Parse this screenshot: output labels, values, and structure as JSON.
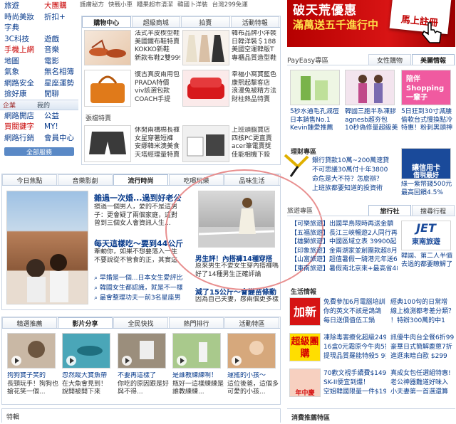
{
  "nav": {
    "rows": [
      [
        "旅遊",
        "大團購"
      ],
      [
        "時尚美妝",
        "折扣+"
      ],
      [
        "字典",
        ""
      ],
      [
        "3C科技",
        "遊戲"
      ],
      [
        "手機上網",
        "音樂"
      ],
      [
        "地圖",
        "電影"
      ],
      [
        "氣象",
        "無名相簿"
      ],
      [
        "網路安全",
        "星座運勢"
      ],
      [
        "撿好康",
        "閒聊"
      ]
    ],
    "enterprise_label": "企業",
    "mine_label": "我的",
    "rows2": [
      [
        "網路開店",
        "公益"
      ],
      [
        "買關鍵字",
        "MY!"
      ],
      [
        "網路行銷",
        "會員中心"
      ]
    ],
    "all_services": "全部服務"
  },
  "topstrip": {
    "items": [
      "護膚秘方",
      "快戰小車",
      "糟果超市清潔",
      "韓國卜洋裝",
      "台灣299免運"
    ]
  },
  "shop": {
    "tabs": [
      "購物中心",
      "超級商城",
      "拍賣",
      "活動特報"
    ],
    "items": [
      [
        "法式羊皮楔型鞋",
        "美國鐵布鞋特賣",
        "KOKKO新鞋",
        "新款布鞋2雙999"
      ],
      [
        "韓布品牌小洋裝",
        "日韓洋裝＄188",
        "美國空運韓版T",
        "專櫃品質造型鞋"
      ],
      [
        "復古真皮兩用包",
        "PRADA特價",
        "viv該選包款",
        "COACH手提"
      ],
      [
        "幸福小窩寶藍色",
        "康熙起擊客店",
        "浪漫兔被精方法",
        "財柱熱品特賣"
      ],
      [
        "休閒兩構棉長褲",
        "女星穿著短褲",
        "安娜韓米澳美食",
        "天塔經理量特賣"
      ],
      [
        "上班頭腦寶店",
        "四核PC更直賣",
        "acer筆電賣獎",
        "佳能相機下殺"
      ]
    ],
    "special_label": "張檔特賣"
  },
  "hero": {
    "line1": "破天荒優惠",
    "line2": "滿萬送五千進行中",
    "button": "馬上註冊"
  },
  "payeasy": {
    "title": "PayEasy專區",
    "tabs": [
      "女性購物",
      "美麗情報"
    ],
    "banner": "陪伴Shopping 一輩子",
    "captions": [
      [
        "5秒水通毛孔減痘",
        "日本銷售No.1",
        "Kevin鍾愛推薦"
      ],
      [
        "韓國三胞半系凍膠",
        "agnesb超夯包",
        "10秒偽修量超級美"
      ],
      [
        "5日狂到30寸減腰",
        "偷軟台式慢換點冷",
        "特惠！粉刺黑頭神"
      ]
    ]
  },
  "finance": {
    "title": "理財專區",
    "items": [
      "銀行貸款10萬~200萬速貸",
      "不可思議30萬付十年3800",
      "命危是大不符？怎麼辦？",
      "上班族都要知道的投資術"
    ],
    "card_title": "讓信用卡",
    "card_sub": "借現最好",
    "card_cap": [
      "綠一紫幣錢500元",
      "最高回饋4.5%"
    ]
  },
  "travel": {
    "title": "旅遊專區",
    "tabs": [
      "旅行社",
      "搜尋行程"
    ],
    "items": [
      "【可樂旅遊】出國早鳥限時再送金額",
      "【五福旅遊】長江三峽暢遊2人同行再4千",
      "【雄獅旅遊】中國區域立表 39900起",
      "【印象旅遊】金兩湖家並創團款超8月",
      "【山富旅遊】超值暑假一騎港元年送6千",
      "【東南旅遊】暑假南北京來+最高省48900"
    ],
    "jet_title": "東南旅遊",
    "jet_cap": [
      "韓國、第二人半價",
      "去過的都要瞭解了"
    ]
  },
  "life": {
    "title": "生活情報",
    "rows": [
      {
        "badge": "加新",
        "lines": [
          "免費參加6月電腦培訓",
          "你的英文不該是鴿鴿",
          "每日送價值伍工鍋"
        ],
        "right": [
          "經典100句的日常增",
          "線上檢測都考差分類？",
          "！特辦300萬的中1"
        ]
      },
      {
        "badge": "超級團購",
        "lines": [
          "凍除毒害療化超級249",
          "16盒0元霜原今牛肉5折",
          "提現品質羅能特殺5 9折"
        ],
        "right": [
          "訊優牛肉台全餐6折99",
          "豪華日式簡解鹿蔥7折",
          "進逛來暗白歐 $299"
        ]
      },
      {
        "badge": "年中慶",
        "lines": [
          "70歡文視手續費$149",
          "SK-II便宜到爆！",
          "空姐韓國限量一件$199"
        ],
        "right": [
          "真成女包任選組特惠!",
          "老公神器難道好味入",
          "小夫妻第一首選還算"
        ]
      }
    ]
  },
  "consumer_title": "消費推薦特區",
  "feature": {
    "tabs": [
      "今日焦點",
      "音樂影劇",
      "流行時尚",
      "吃喝玩樂",
      "品味生活"
    ],
    "main_title": "雜過一次婚...過到好老公",
    "main_text": [
      "擦過一個男人，愛的不是這男",
      "子：更會疑了兩個家庭，這對",
      "曾到三個女人會資訊人生..."
    ],
    "sub_title": "每天這樣吃～要到44公斤",
    "sub_text": [
      "牽動你，如果不想要落入一生",
      "不要說從不管食的正，其實這"
    ],
    "links": [
      "早婚是一個...日本女生愛評比",
      "韓國女生都認識，就是不一樣",
      "最會整理功夫一前3名星座男"
    ],
    "side_title": "男生評！內搭褲14種穿搭",
    "side_text": [
      "原來男生不愛女生穿內搭褲嗎",
      "好了14種男生正確評論"
    ],
    "side_link_title": "減了15公斤～會變苗條動",
    "side_link_text": "因為自己夫妻，感兩個更多樣"
  },
  "video": {
    "tabs": [
      "精選推薦",
      "影片分享",
      "全民快找",
      "熱門排行",
      "活動特區"
    ],
    "captions": [
      [
        "狗狗寶子笑的",
        "長頸玩手！狗狗也",
        "搶花笑一個..."
      ],
      [
        "忽然蹤大寶魚帶",
        "在大魚會見到！",
        "說開被開下來"
      ],
      [
        "不要再這樣了",
        "你吃的原因跟是好",
        "與不得..."
      ],
      [
        "是誰教練練啊！",
        "瓶好一這樣練練是",
        "誰教練練..."
      ],
      [
        "運搖的小孩～",
        "這位後爸，這個多",
        "可愛的小孩..."
      ]
    ]
  },
  "bottom_label": "特輯"
}
